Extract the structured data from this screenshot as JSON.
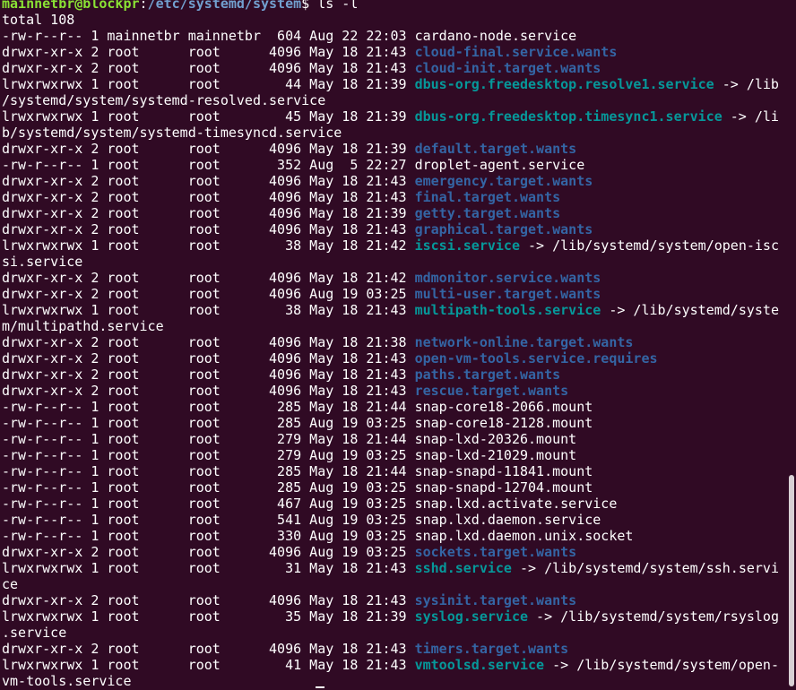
{
  "prompt": {
    "user_host": "mainnetbr@blockpr",
    "sep": ":",
    "path": "/etc/systemd/system",
    "symbol": "$ ",
    "command": "ls -l"
  },
  "total": "total 108",
  "lines": [
    {
      "prefix": "-rw-r--r-- 1 mainnetbr mainnetbr  604 Aug 22 22:03 ",
      "name": "cardano-node.service",
      "type": "file",
      "suffix": ""
    },
    {
      "prefix": "drwxr-xr-x 2 root      root      4096 May 18 21:43 ",
      "name": "cloud-final.service.wants",
      "type": "dir",
      "suffix": ""
    },
    {
      "prefix": "drwxr-xr-x 2 root      root      4096 May 18 21:43 ",
      "name": "cloud-init.target.wants",
      "type": "dir",
      "suffix": ""
    },
    {
      "prefix": "lrwxrwxrwx 1 root      root        44 May 18 21:39 ",
      "name": "dbus-org.freedesktop.resolve1.service",
      "type": "link",
      "suffix": " -> /lib"
    },
    {
      "prefix": "/systemd/system/systemd-resolved.service",
      "name": "",
      "type": "file",
      "suffix": ""
    },
    {
      "prefix": "lrwxrwxrwx 1 root      root        45 May 18 21:39 ",
      "name": "dbus-org.freedesktop.timesync1.service",
      "type": "link",
      "suffix": " -> /li"
    },
    {
      "prefix": "b/systemd/system/systemd-timesyncd.service",
      "name": "",
      "type": "file",
      "suffix": ""
    },
    {
      "prefix": "drwxr-xr-x 2 root      root      4096 May 18 21:39 ",
      "name": "default.target.wants",
      "type": "dir",
      "suffix": ""
    },
    {
      "prefix": "-rw-r--r-- 1 root      root       352 Aug  5 22:27 ",
      "name": "droplet-agent.service",
      "type": "file",
      "suffix": ""
    },
    {
      "prefix": "drwxr-xr-x 2 root      root      4096 May 18 21:43 ",
      "name": "emergency.target.wants",
      "type": "dir",
      "suffix": ""
    },
    {
      "prefix": "drwxr-xr-x 2 root      root      4096 May 18 21:43 ",
      "name": "final.target.wants",
      "type": "dir",
      "suffix": ""
    },
    {
      "prefix": "drwxr-xr-x 2 root      root      4096 May 18 21:39 ",
      "name": "getty.target.wants",
      "type": "dir",
      "suffix": ""
    },
    {
      "prefix": "drwxr-xr-x 2 root      root      4096 May 18 21:43 ",
      "name": "graphical.target.wants",
      "type": "dir",
      "suffix": ""
    },
    {
      "prefix": "lrwxrwxrwx 1 root      root        38 May 18 21:42 ",
      "name": "iscsi.service",
      "type": "link",
      "suffix": " -> /lib/systemd/system/open-isc"
    },
    {
      "prefix": "si.service",
      "name": "",
      "type": "file",
      "suffix": ""
    },
    {
      "prefix": "drwxr-xr-x 2 root      root      4096 May 18 21:42 ",
      "name": "mdmonitor.service.wants",
      "type": "dir",
      "suffix": ""
    },
    {
      "prefix": "drwxr-xr-x 2 root      root      4096 Aug 19 03:25 ",
      "name": "multi-user.target.wants",
      "type": "dir",
      "suffix": ""
    },
    {
      "prefix": "lrwxrwxrwx 1 root      root        38 May 18 21:43 ",
      "name": "multipath-tools.service",
      "type": "link",
      "suffix": " -> /lib/systemd/syste"
    },
    {
      "prefix": "m/multipathd.service",
      "name": "",
      "type": "file",
      "suffix": ""
    },
    {
      "prefix": "drwxr-xr-x 2 root      root      4096 May 18 21:38 ",
      "name": "network-online.target.wants",
      "type": "dir",
      "suffix": ""
    },
    {
      "prefix": "drwxr-xr-x 2 root      root      4096 May 18 21:43 ",
      "name": "open-vm-tools.service.requires",
      "type": "dir",
      "suffix": ""
    },
    {
      "prefix": "drwxr-xr-x 2 root      root      4096 May 18 21:43 ",
      "name": "paths.target.wants",
      "type": "dir",
      "suffix": ""
    },
    {
      "prefix": "drwxr-xr-x 2 root      root      4096 May 18 21:43 ",
      "name": "rescue.target.wants",
      "type": "dir",
      "suffix": ""
    },
    {
      "prefix": "-rw-r--r-- 1 root      root       285 May 18 21:44 ",
      "name": "snap-core18-2066.mount",
      "type": "file",
      "suffix": ""
    },
    {
      "prefix": "-rw-r--r-- 1 root      root       285 Aug 19 03:25 ",
      "name": "snap-core18-2128.mount",
      "type": "file",
      "suffix": ""
    },
    {
      "prefix": "-rw-r--r-- 1 root      root       279 May 18 21:44 ",
      "name": "snap-lxd-20326.mount",
      "type": "file",
      "suffix": ""
    },
    {
      "prefix": "-rw-r--r-- 1 root      root       279 Aug 19 03:25 ",
      "name": "snap-lxd-21029.mount",
      "type": "file",
      "suffix": ""
    },
    {
      "prefix": "-rw-r--r-- 1 root      root       285 May 18 21:44 ",
      "name": "snap-snapd-11841.mount",
      "type": "file",
      "suffix": ""
    },
    {
      "prefix": "-rw-r--r-- 1 root      root       285 Aug 19 03:25 ",
      "name": "snap-snapd-12704.mount",
      "type": "file",
      "suffix": ""
    },
    {
      "prefix": "-rw-r--r-- 1 root      root       467 Aug 19 03:25 ",
      "name": "snap.lxd.activate.service",
      "type": "file",
      "suffix": ""
    },
    {
      "prefix": "-rw-r--r-- 1 root      root       541 Aug 19 03:25 ",
      "name": "snap.lxd.daemon.service",
      "type": "file",
      "suffix": ""
    },
    {
      "prefix": "-rw-r--r-- 1 root      root       330 Aug 19 03:25 ",
      "name": "snap.lxd.daemon.unix.socket",
      "type": "file",
      "suffix": ""
    },
    {
      "prefix": "drwxr-xr-x 2 root      root      4096 Aug 19 03:25 ",
      "name": "sockets.target.wants",
      "type": "dir",
      "suffix": ""
    },
    {
      "prefix": "lrwxrwxrwx 1 root      root        31 May 18 21:43 ",
      "name": "sshd.service",
      "type": "link",
      "suffix": " -> /lib/systemd/system/ssh.servi"
    },
    {
      "prefix": "ce",
      "name": "",
      "type": "file",
      "suffix": ""
    },
    {
      "prefix": "drwxr-xr-x 2 root      root      4096 May 18 21:43 ",
      "name": "sysinit.target.wants",
      "type": "dir",
      "suffix": ""
    },
    {
      "prefix": "lrwxrwxrwx 1 root      root        35 May 18 21:39 ",
      "name": "syslog.service",
      "type": "link",
      "suffix": " -> /lib/systemd/system/rsyslog"
    },
    {
      "prefix": ".service",
      "name": "",
      "type": "file",
      "suffix": ""
    },
    {
      "prefix": "drwxr-xr-x 2 root      root      4096 May 18 21:43 ",
      "name": "timers.target.wants",
      "type": "dir",
      "suffix": ""
    },
    {
      "prefix": "lrwxrwxrwx 1 root      root        41 May 18 21:43 ",
      "name": "vmtoolsd.service",
      "type": "link",
      "suffix": " -> /lib/systemd/system/open-"
    },
    {
      "prefix": "vm-tools.service",
      "name": "",
      "type": "file",
      "suffix": ""
    }
  ],
  "colors": {
    "background": "#300a24",
    "text": "#ffffff",
    "prompt_user": "#8ae234",
    "prompt_path": "#729fcf",
    "directory": "#3465a4",
    "symlink": "#06989a"
  }
}
